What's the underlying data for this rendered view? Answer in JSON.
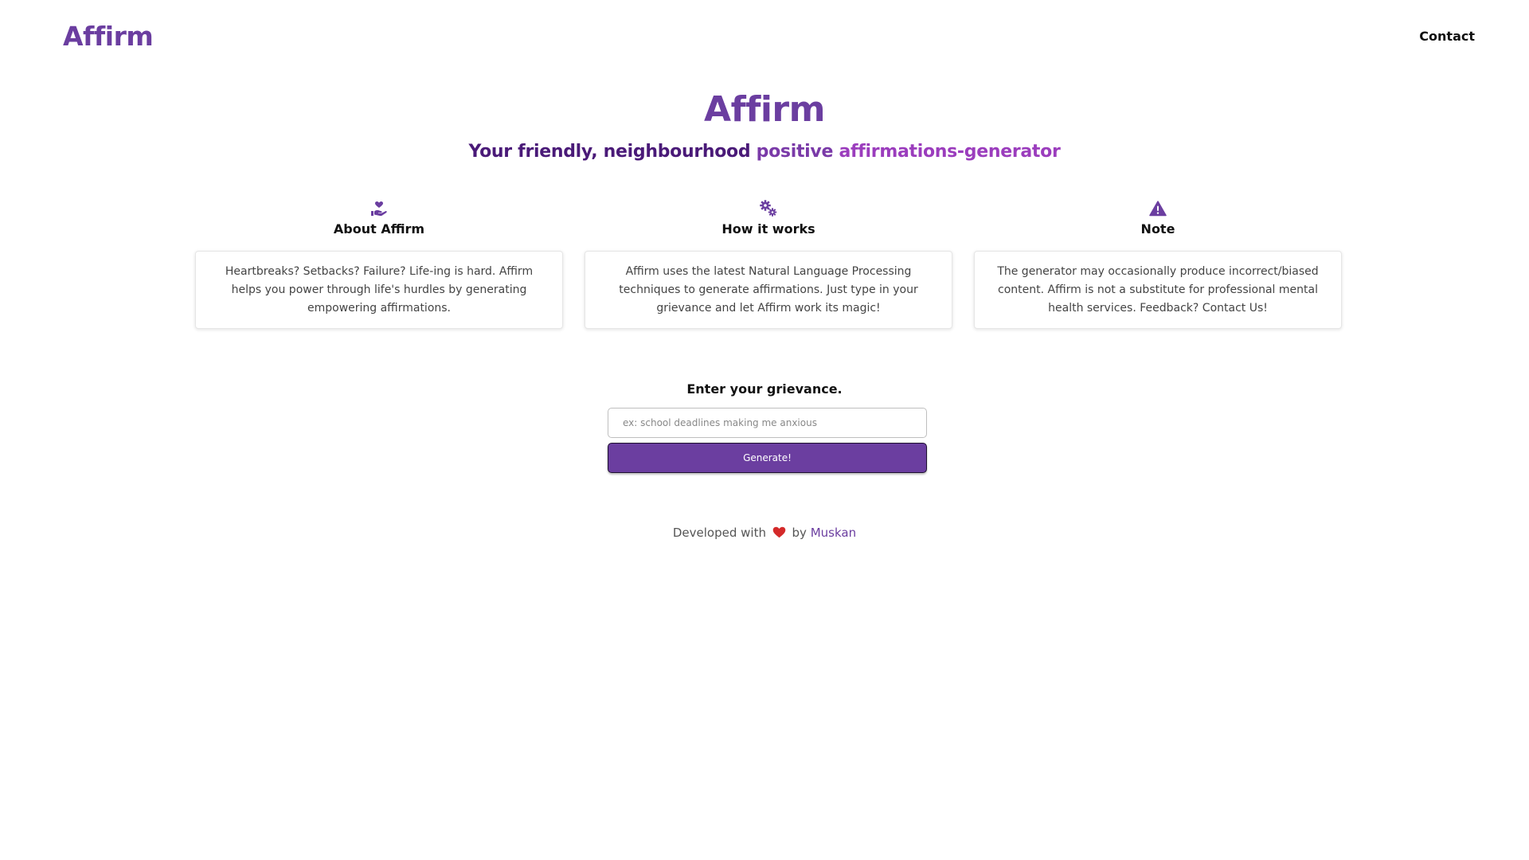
{
  "navbar": {
    "brand": "Affirm",
    "contact_label": "Contact"
  },
  "hero": {
    "title": "Affirm",
    "subtitle_part1": "Your friendly, neighbourhood ",
    "subtitle_part2": "positive ",
    "subtitle_part3": "affirmations-generator"
  },
  "features": {
    "about": {
      "icon": "hand-holding-heart-icon",
      "title": "About Affirm",
      "text": "Heartbreaks? Setbacks? Failure? Life-ing is hard. Affirm helps you power through life's hurdles by generating empowering affirmations."
    },
    "how": {
      "icon": "gears-icon",
      "title": "How it works",
      "text": "Affirm uses the latest Natural Language Processing techniques to generate affirmations. Just type in your grievance and let Affirm work its magic!"
    },
    "note": {
      "icon": "warning-icon",
      "title": "Note",
      "text": "The generator may occasionally produce incorrect/biased content. Affirm is not a substitute for professional mental health services. Feedback? Contact Us!"
    }
  },
  "form": {
    "label": "Enter your grievance.",
    "input_value": "",
    "input_placeholder": "ex: school deadlines making me anxious",
    "button_label": "Generate!"
  },
  "footer": {
    "prefix": "Developed with",
    "heart_icon": "heart-icon",
    "by": "by",
    "author": "Muskan"
  },
  "colors": {
    "brand_purple": "#6b3ea0",
    "subtitle_dark": "#4a1a78",
    "subtitle_magenta": "#9b3dbd",
    "heart_red": "#d42a2a"
  }
}
